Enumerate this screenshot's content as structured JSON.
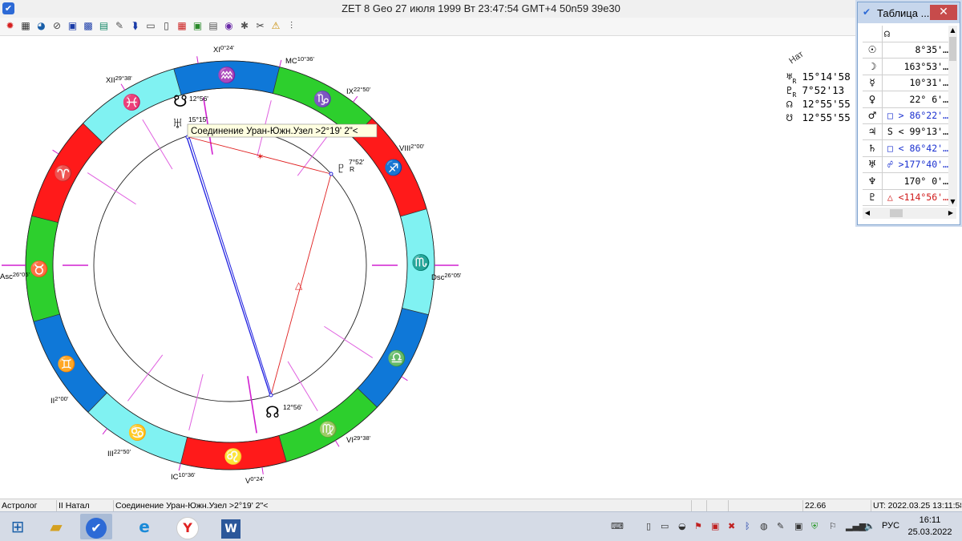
{
  "window": {
    "title": "ZET 8 Geo   27 июля 1999  Вт  23:47:54 GMT+4 50n59  39e30",
    "app_icon": "app-logo-icon"
  },
  "toolbar": [
    {
      "icon": "gear-red-icon",
      "glyph": "✹",
      "color": "#d62020"
    },
    {
      "icon": "table-grid-icon",
      "glyph": "▦",
      "color": "#333333"
    },
    {
      "icon": "globe-icon",
      "glyph": "◕",
      "color": "#1a5fa8"
    },
    {
      "icon": "compass-icon",
      "glyph": "⊘",
      "color": "#444444"
    },
    {
      "icon": "blue-square-icon",
      "glyph": "▣",
      "color": "#1a3ca8"
    },
    {
      "icon": "blue-grid-icon",
      "glyph": "▩",
      "color": "#1a3ca8"
    },
    {
      "icon": "chart-icon",
      "glyph": "▤",
      "color": "#1a8a6a"
    },
    {
      "icon": "paint-icon",
      "glyph": "✎",
      "color": "#555555"
    },
    {
      "icon": "arrow-icon",
      "glyph": "⮯",
      "color": "#1a3ca8"
    },
    {
      "icon": "window-icon",
      "glyph": "▭",
      "color": "#444444"
    },
    {
      "icon": "document-icon",
      "glyph": "▯",
      "color": "#444444"
    },
    {
      "icon": "calendar-icon",
      "glyph": "▦",
      "color": "#cc2222"
    },
    {
      "icon": "image-icon",
      "glyph": "▣",
      "color": "#2a8a2a"
    },
    {
      "icon": "page-icon",
      "glyph": "▤",
      "color": "#555555"
    },
    {
      "icon": "target-icon",
      "glyph": "◉",
      "color": "#6a2aa8"
    },
    {
      "icon": "settings-icon",
      "glyph": "✱",
      "color": "#555555"
    },
    {
      "icon": "tools-icon",
      "glyph": "✂",
      "color": "#444444"
    },
    {
      "icon": "warning-icon",
      "glyph": "⚠",
      "color": "#c88a00"
    },
    {
      "icon": "graph-icon",
      "glyph": "⫶",
      "color": "#333333"
    }
  ],
  "chart": {
    "tooltip": "Соединение Уран-Южн.Узел >2°19' 2\"<",
    "signs": [
      {
        "glyph": "♒",
        "color": "#0f78d8"
      },
      {
        "glyph": "♑",
        "color": "#2dcf2d"
      },
      {
        "glyph": "♐",
        "color": "#ff1a1a"
      },
      {
        "glyph": "♏",
        "color": "#80f2f2"
      },
      {
        "glyph": "♎",
        "color": "#0f78d8"
      },
      {
        "glyph": "♍",
        "color": "#2dcf2d"
      },
      {
        "glyph": "♌",
        "color": "#ff1a1a"
      },
      {
        "glyph": "♋",
        "color": "#80f2f2"
      },
      {
        "glyph": "♊",
        "color": "#0f78d8"
      },
      {
        "glyph": "♉",
        "color": "#2dcf2d"
      },
      {
        "glyph": "♈",
        "color": "#ff1a1a"
      },
      {
        "glyph": "♓",
        "color": "#80f2f2"
      }
    ],
    "cusps": [
      {
        "name": "Asc",
        "deg": "26°05'"
      },
      {
        "name": "II",
        "deg": "2°00'"
      },
      {
        "name": "III",
        "deg": "22°50'"
      },
      {
        "name": "IC",
        "deg": "10°36'"
      },
      {
        "name": "V",
        "deg": "0°24'"
      },
      {
        "name": "VI",
        "deg": "29°38'"
      },
      {
        "name": "Dsc",
        "deg": "26°05'"
      },
      {
        "name": "VIII",
        "deg": "2°00'"
      },
      {
        "name": "IX",
        "deg": "22°50'"
      },
      {
        "name": "MC",
        "deg": "10°36'"
      },
      {
        "name": "XI",
        "deg": "0°24'"
      },
      {
        "name": "XII",
        "deg": "29°38'"
      }
    ],
    "planets": [
      {
        "glyph": "☋",
        "deg": "12°56'",
        "icon": "south-node-icon"
      },
      {
        "glyph": "♅",
        "deg": "15°15'",
        "icon": "uranus-icon"
      },
      {
        "glyph": "♇",
        "deg": "7°52'",
        "suffix": "R",
        "icon": "pluto-icon"
      },
      {
        "glyph": "☊",
        "deg": "12°56'",
        "icon": "north-node-icon"
      }
    ]
  },
  "side_positions": {
    "label": "Нат",
    "items": [
      {
        "glyph": "♅",
        "r": "R",
        "value": "15°14'58"
      },
      {
        "glyph": "♇",
        "r": "R",
        "value": "7°52'13"
      },
      {
        "glyph": "☊",
        "r": "",
        "value": "12°55'55"
      },
      {
        "glyph": "☋",
        "r": "",
        "value": "12°55'55"
      }
    ]
  },
  "table_window": {
    "title": "Таблица ...",
    "close": "✕",
    "header": "☊",
    "rows": [
      {
        "glyph": "☉",
        "value": "8°35'…",
        "color": "#000000"
      },
      {
        "glyph": "☽",
        "value": "163°53'…",
        "color": "#000000"
      },
      {
        "glyph": "☿",
        "value": "10°31'…",
        "color": "#000000"
      },
      {
        "glyph": "♀",
        "value": "22° 6'…",
        "color": "#000000"
      },
      {
        "glyph": "♂",
        "value": "□ > 86°22'…",
        "color": "#1a30d0"
      },
      {
        "glyph": "♃",
        "value": "S < 99°13'…",
        "color": "#000000"
      },
      {
        "glyph": "♄",
        "value": "□ < 86°42'…",
        "color": "#1a30d0"
      },
      {
        "glyph": "♅",
        "value": "☍ >177°40'…",
        "color": "#1a30d0"
      },
      {
        "glyph": "♆",
        "value": "170° 0'…",
        "color": "#000000"
      },
      {
        "glyph": "♇",
        "value": "△ <114°56'…",
        "color": "#d01a1a"
      }
    ]
  },
  "statusbar": {
    "role": "Астролог",
    "chart": "II Натал",
    "aspect": "Соединение Уран-Южн.Узел >2°19' 2\"<",
    "value": "22.66",
    "ut": "UT: 2022.03.25 13:11:58"
  },
  "taskbar": {
    "lang": "РУС",
    "time": "16:11",
    "date": "25.03.2022"
  }
}
